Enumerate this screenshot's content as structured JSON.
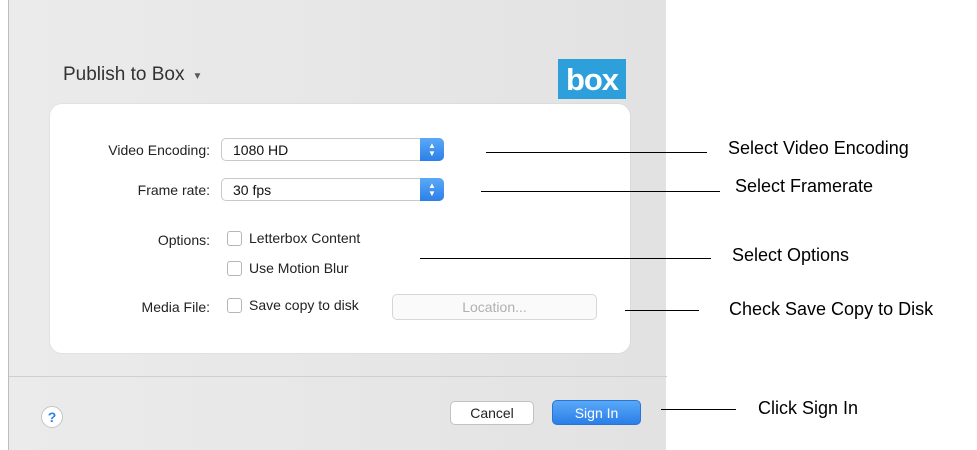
{
  "dialog": {
    "title": "Publish to Box",
    "title_caret_icon": "chevron-down-icon",
    "logo_text": "box",
    "logo_color": "#2d9fdb"
  },
  "form": {
    "video_encoding": {
      "label": "Video Encoding:",
      "value": "1080 HD"
    },
    "frame_rate": {
      "label": "Frame rate:",
      "value": "30 fps"
    },
    "options": {
      "label": "Options:",
      "letterbox": "Letterbox Content",
      "motion_blur": "Use Motion Blur"
    },
    "media_file": {
      "label": "Media File:",
      "save_copy": "Save copy to disk",
      "location_button": "Location..."
    }
  },
  "footer": {
    "help": "?",
    "cancel": "Cancel",
    "sign_in": "Sign In",
    "accent_color": "#2f80ed"
  },
  "callouts": {
    "encoding": "Select Video Encoding",
    "framerate": "Select Framerate",
    "options": "Select Options",
    "save_copy": "Check Save Copy to Disk",
    "sign_in": "Click Sign In"
  }
}
